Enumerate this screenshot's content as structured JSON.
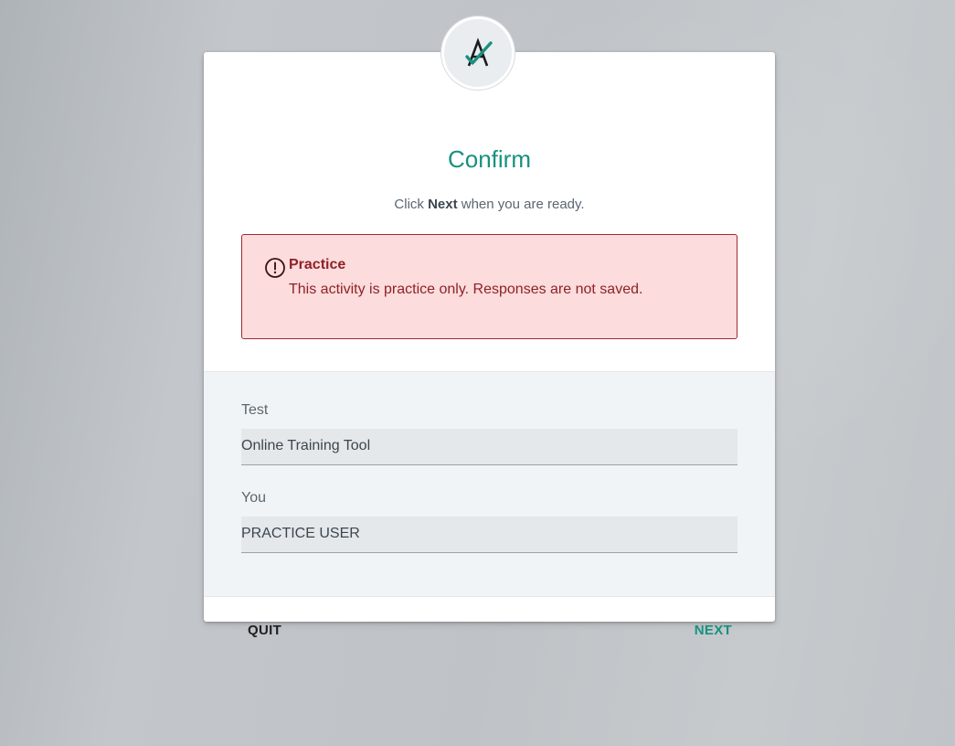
{
  "dialog": {
    "title": "Confirm",
    "subtitle_prefix": "Click ",
    "subtitle_bold": "Next",
    "subtitle_suffix": " when you are ready."
  },
  "alert": {
    "icon": "exclamation-circle-icon",
    "title": "Practice",
    "message": "This activity is practice only. Responses are not saved."
  },
  "fields": {
    "test_label": "Test",
    "test_value": "Online Training Tool",
    "you_label": "You",
    "you_value": "PRACTICE USER"
  },
  "footer": {
    "quit_label": "QUIT",
    "next_label": "NEXT"
  },
  "logo": {
    "icon": "logo-a-check-icon"
  },
  "colors": {
    "accent": "#17917f",
    "alert_bg": "#fcdcdc",
    "alert_text": "#8e2228"
  }
}
